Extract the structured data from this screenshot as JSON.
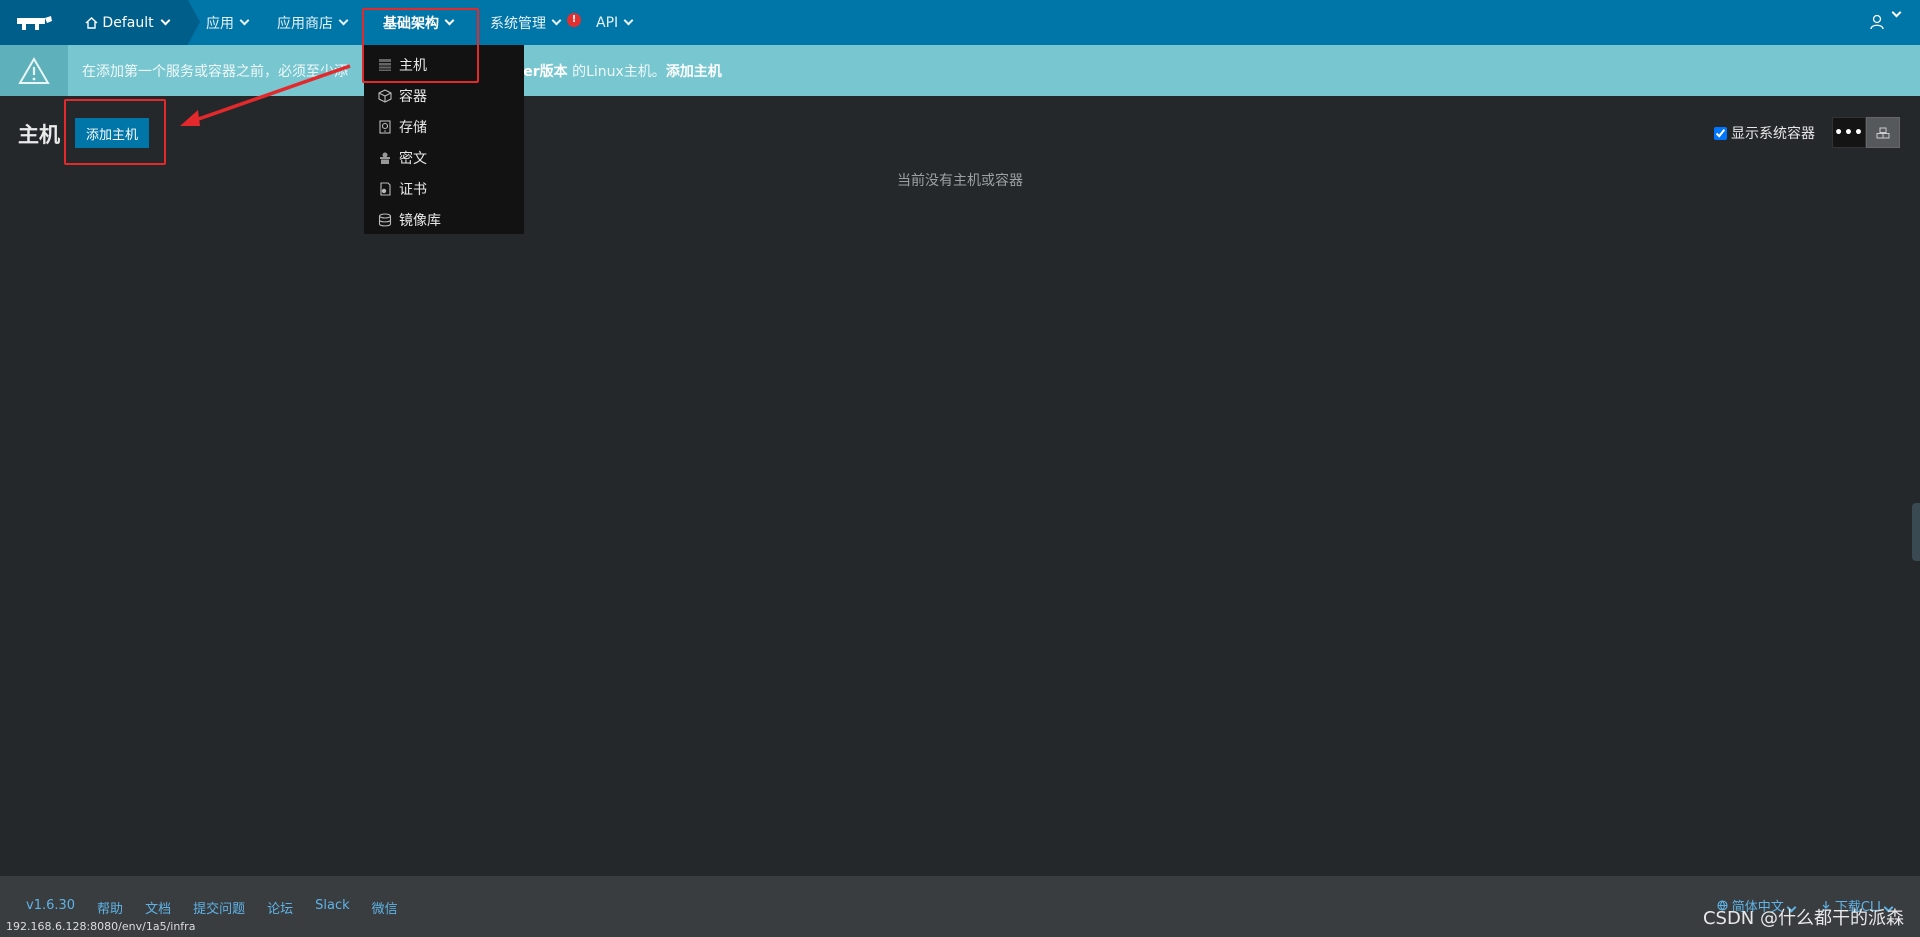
{
  "nav": {
    "environment": "Default",
    "items": [
      "应用",
      "应用商店",
      "基础架构",
      "系统管理",
      "API"
    ],
    "alert_badge": "!"
  },
  "banner": {
    "text_part1": "在添加第一个服务或容器之前，必须至少添",
    "text_part2": "cker版本",
    "text_part3": " 的Linux主机。",
    "link": "添加主机"
  },
  "dropdown": {
    "items": [
      {
        "label": "主机",
        "icon": "server-icon"
      },
      {
        "label": "容器",
        "icon": "cube-icon"
      },
      {
        "label": "存储",
        "icon": "storage-icon"
      },
      {
        "label": "密文",
        "icon": "secret-icon"
      },
      {
        "label": "证书",
        "icon": "certificate-icon"
      },
      {
        "label": "镜像库",
        "icon": "database-icon"
      }
    ]
  },
  "page": {
    "title": "主机",
    "add_button": "添加主机",
    "empty_message": "当前没有主机或容器",
    "show_system_label": "显示系统容器",
    "show_system_checked": true,
    "dots": "•••"
  },
  "footer": {
    "links": [
      "v1.6.30",
      "帮助",
      "文档",
      "提交问题",
      "论坛",
      "Slack",
      "微信"
    ],
    "language": "简体中文",
    "download": "下载CLI",
    "status_url": "192.168.6.128:8080/env/1a5/infra",
    "watermark": "CSDN @什么都干的派森"
  },
  "colors": {
    "nav_bg": "#0075a8",
    "banner_bg": "#78c6d0",
    "annotation": "#e3292b"
  }
}
